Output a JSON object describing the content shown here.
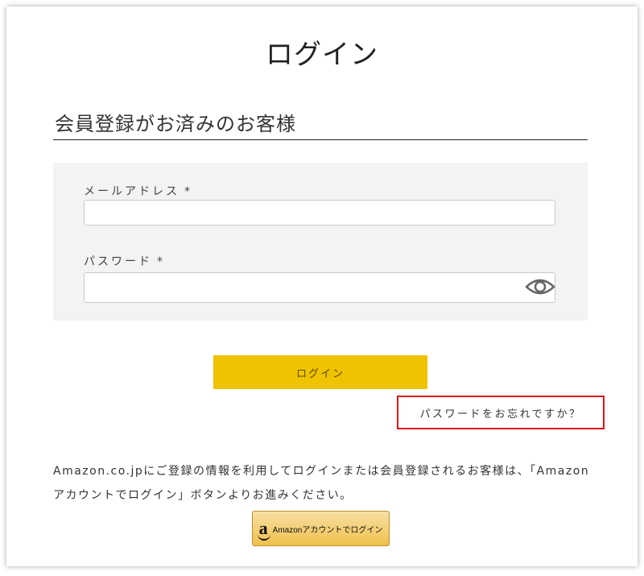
{
  "page": {
    "title": "ログイン"
  },
  "member_section": {
    "title": "会員登録がお済みのお客様"
  },
  "form": {
    "email": {
      "label": "メールアドレス",
      "required_mark": "*",
      "value": "",
      "placeholder": ""
    },
    "password": {
      "label": "パスワード",
      "required_mark": "*",
      "value": "",
      "placeholder": "",
      "toggle_icon": "eye-icon"
    },
    "login_button": "ログイン",
    "forgot_password_link": "パスワードをお忘れですか？"
  },
  "amazon": {
    "notice": "Amazon.co.jpにご登録の情報を利用してログインまたは会員登録されるお客様は、「Amazonアカウントでログイン」ボタンよりお進みください。",
    "button_logo": "a",
    "button_label": "Amazonアカウントでログイン"
  },
  "colors": {
    "login_button": "#f0c300",
    "highlight_border": "#e2121c",
    "panel_background": "#f3f3f2"
  }
}
